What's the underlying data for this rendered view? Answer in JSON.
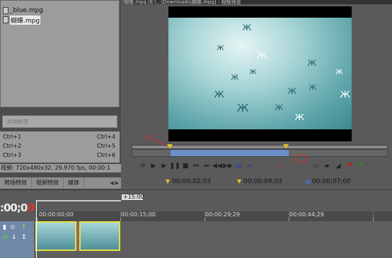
{
  "preview": {
    "title": "蝴蝶.mpg [E:\\...\\Downloads\\蝴蝶.mpg] - 视频预览",
    "in_label": "入点",
    "in_time": "00:00:02;03",
    "out_time": "00:00:09;03",
    "length_time": "00:00:07;00"
  },
  "explorer": {
    "files": [
      {
        "name": "_blue.mpg",
        "selected": false
      },
      {
        "name": "蝴蝶.mpg",
        "selected": true
      }
    ],
    "tag_placeholder": "添加标签",
    "shortcuts": [
      "Ctrl+1",
      "Ctrl+2",
      "Ctrl+3",
      "Ctrl+4",
      "Ctrl+5",
      "Ctrl+6"
    ],
    "video_info": "视频: 720x480x32, 29.970 fps, 00:00:1",
    "tabs": [
      "转场特效",
      "视频特效",
      "媒体"
    ]
  },
  "timeline": {
    "cursor_time_main": ":00;0",
    "cursor_time_red": "0",
    "selection_length": "+15:00",
    "ruler": [
      "00:00:00;00",
      "00:00:15;00",
      "00:00:29;29",
      "00:00:44;29"
    ]
  },
  "colors": {
    "accent_marker": "#e8c020",
    "annotation_red": "#e03030",
    "selection_blue": "#6b8fc8",
    "clip_border": "#e4e040"
  }
}
